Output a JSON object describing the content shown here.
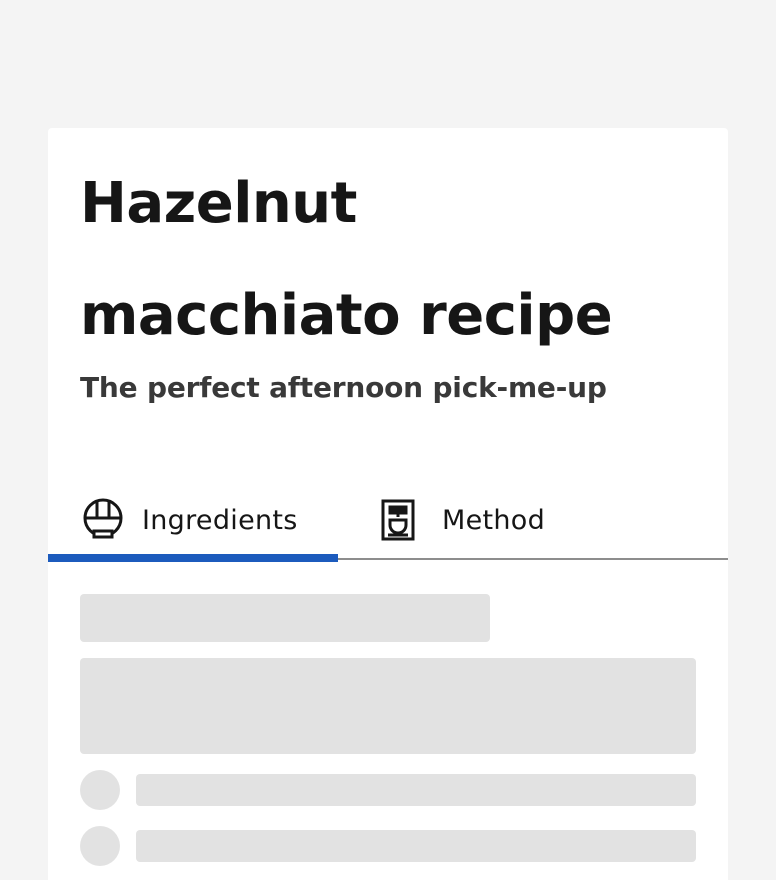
{
  "recipe": {
    "title": "Hazelnut macchiato recipe",
    "subtitle": "The perfect afternoon pick-me-up"
  },
  "tabs": [
    {
      "label": "Ingredients",
      "icon": "bowl-icon",
      "active": true
    },
    {
      "label": "Method",
      "icon": "coffee-maker-icon",
      "active": false
    }
  ],
  "colors": {
    "background": "#f4f4f4",
    "card": "#ffffff",
    "active_tab_indicator": "#1c5bbd",
    "skeleton": "#e0e0e0",
    "tab_border": "#8d8d8d"
  }
}
